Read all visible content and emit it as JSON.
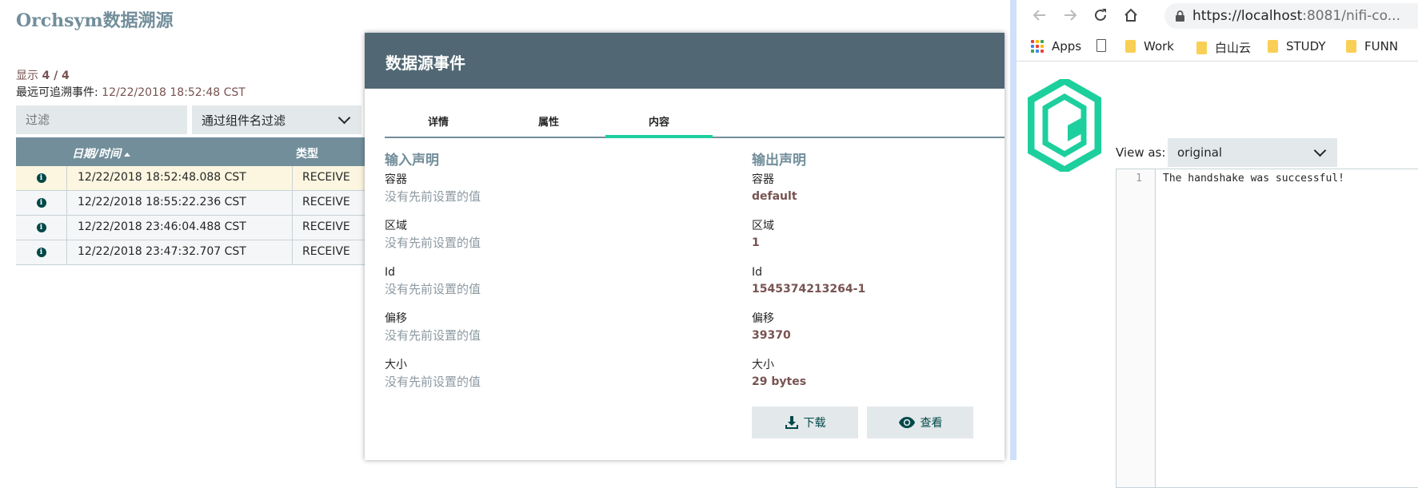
{
  "app": {
    "title": "Orchsym数据溯源",
    "showing_label": "显示",
    "showing_count": "4 / 4",
    "oldest_label": "最远可追溯事件: ",
    "oldest_value": "12/22/2018 18:52:48 CST"
  },
  "filter": {
    "placeholder": "过滤",
    "select_value": "通过组件名过滤"
  },
  "grid": {
    "headers": {
      "date": "日期/时间",
      "type": "类型"
    },
    "rows": [
      {
        "date": "12/22/2018 18:52:48.088 CST",
        "type": "RECEIVE",
        "selected": true
      },
      {
        "date": "12/22/2018 18:55:22.236 CST",
        "type": "RECEIVE"
      },
      {
        "date": "12/22/2018 23:46:04.488 CST",
        "type": "RECEIVE"
      },
      {
        "date": "12/22/2018 23:47:32.707 CST",
        "type": "RECEIVE"
      }
    ]
  },
  "modal": {
    "title": "数据源事件",
    "tabs": [
      {
        "label": "详情"
      },
      {
        "label": "属性"
      },
      {
        "label": "内容",
        "active": true
      }
    ],
    "input_claim": {
      "title": "输入声明",
      "fields": [
        {
          "label": "容器",
          "value": "没有先前设置的值"
        },
        {
          "label": "区域",
          "value": "没有先前设置的值"
        },
        {
          "label": "Id",
          "value": "没有先前设置的值"
        },
        {
          "label": "偏移",
          "value": "没有先前设置的值"
        },
        {
          "label": "大小",
          "value": "没有先前设置的值"
        }
      ]
    },
    "output_claim": {
      "title": "输出声明",
      "fields": [
        {
          "label": "容器",
          "value": "default"
        },
        {
          "label": "区域",
          "value": "1"
        },
        {
          "label": "Id",
          "value": "1545374213264-1"
        },
        {
          "label": "偏移",
          "value": "39370"
        },
        {
          "label": "大小",
          "value": "29 bytes"
        }
      ]
    },
    "buttons": {
      "download": "下载",
      "view": "查看"
    }
  },
  "browser": {
    "url_host": "https://localhost",
    "url_rest": ":8081/nifi-co...",
    "bookmarks": [
      {
        "label": "Apps",
        "icon": "apps-grid-icon"
      },
      {
        "label": "",
        "icon": "page-icon"
      },
      {
        "label": "Work",
        "icon": "folder-icon"
      },
      {
        "label": "白山云",
        "icon": "folder-icon"
      },
      {
        "label": "STUDY",
        "icon": "folder-icon"
      },
      {
        "label": "FUNN",
        "icon": "folder-icon"
      }
    ],
    "view_as_label": "View as:",
    "view_as_value": "original",
    "editor": {
      "line_number": "1",
      "content": "The handshake was successful!"
    }
  },
  "colors": {
    "accent": "#1dcf9c",
    "header": "#516874",
    "slate": "#728e9b",
    "value": "#775351"
  }
}
